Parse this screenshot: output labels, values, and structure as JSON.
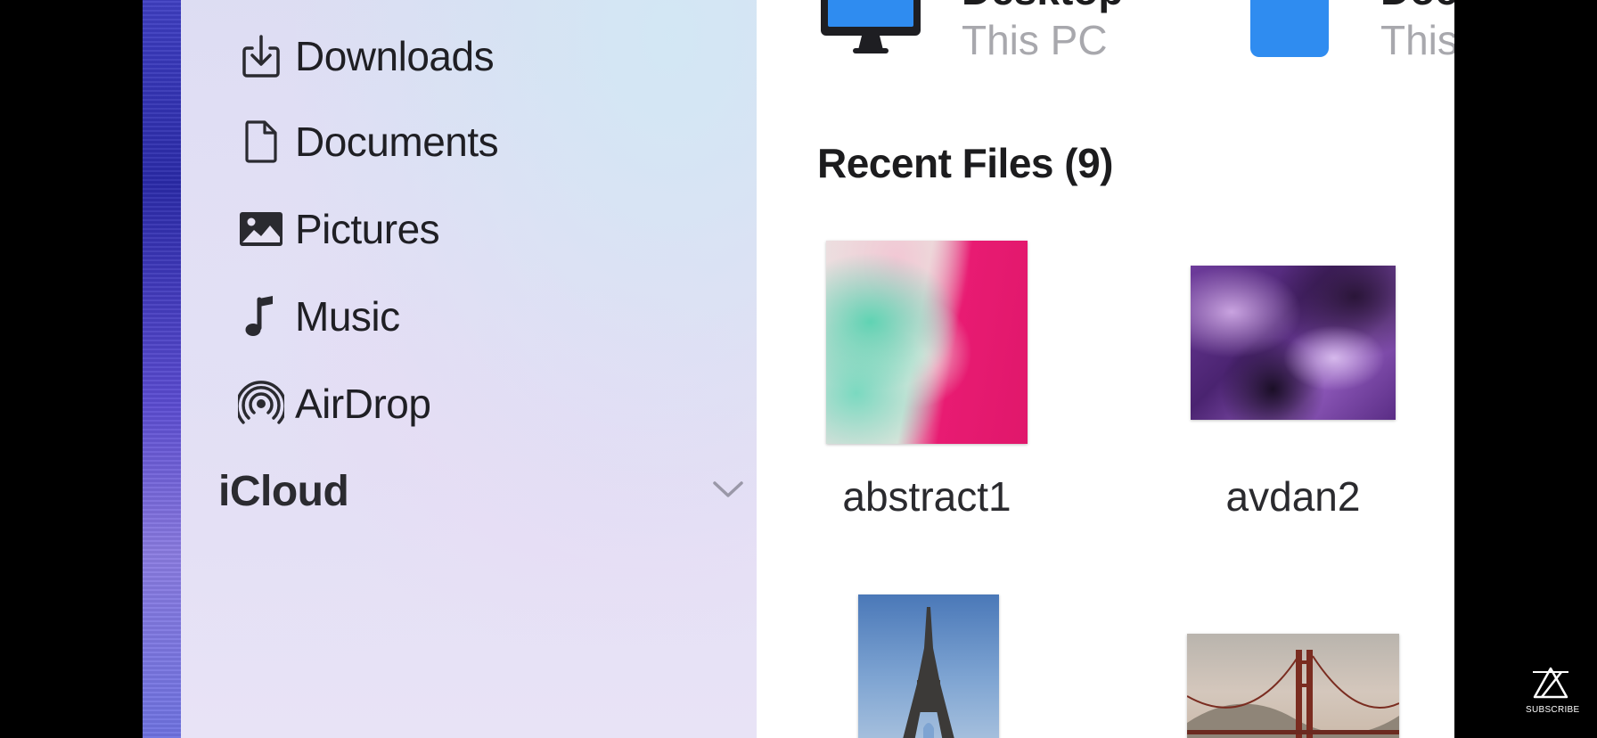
{
  "sidebar": {
    "items": [
      {
        "label": "Downloads",
        "icon": "download-icon"
      },
      {
        "label": "Documents",
        "icon": "document-icon"
      },
      {
        "label": "Pictures",
        "icon": "photo-icon"
      },
      {
        "label": "Music",
        "icon": "music-note-icon"
      },
      {
        "label": "AirDrop",
        "icon": "airdrop-icon"
      }
    ],
    "icloud": {
      "title": "iCloud",
      "icon": "chevron-down-icon"
    }
  },
  "locations": [
    {
      "name": "Desktop",
      "subtitle": "This PC",
      "icon": "desktop-monitor-icon"
    },
    {
      "name": "Documents",
      "subtitle": "This PC",
      "icon": "folder-icon"
    }
  ],
  "recent": {
    "title": "Recent Files (9)",
    "files": [
      {
        "name": "abstract1"
      },
      {
        "name": "avdan2"
      },
      {
        "name": ""
      },
      {
        "name": ""
      }
    ]
  },
  "watermark": {
    "label": "SUBSCRIBE",
    "icon": "channel-logo-icon"
  },
  "colors": {
    "accent_blue": "#2f8cf0",
    "text_primary": "#1c1c1e",
    "text_secondary": "#a8a8ad"
  }
}
